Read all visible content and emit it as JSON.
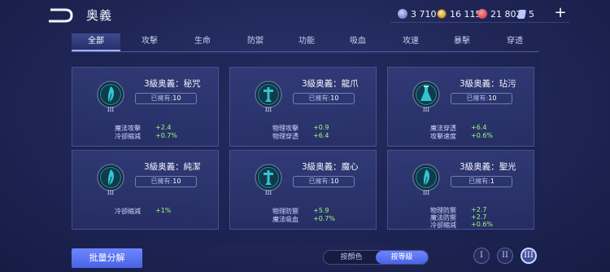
{
  "header": {
    "title": "奥義",
    "resources": {
      "gems": "3 710",
      "gold": "16 115",
      "ruby": "21 802",
      "tickets": "5"
    },
    "add_label": "+"
  },
  "tabs": [
    {
      "label": "全部",
      "active": true
    },
    {
      "label": "攻擊"
    },
    {
      "label": "生命"
    },
    {
      "label": "防禦"
    },
    {
      "label": "功能"
    },
    {
      "label": "吸血"
    },
    {
      "label": "攻速"
    },
    {
      "label": "暴擊"
    },
    {
      "label": "穿透"
    }
  ],
  "cards": [
    {
      "name": "3級奥義：秘咒",
      "owned_prefix": "已擁有:",
      "owned": "10",
      "emblem": "feather-icon",
      "stats": [
        {
          "name": "魔法攻擊",
          "value": "+2.4"
        },
        {
          "name": "冷卻縮減",
          "value": "+0.7%"
        }
      ]
    },
    {
      "name": "3級奥義：龍爪",
      "owned_prefix": "已擁有:",
      "owned": "10",
      "emblem": "figure-icon",
      "stats": [
        {
          "name": "物理攻擊",
          "value": "+0.9"
        },
        {
          "name": "物理穿透",
          "value": "+6.4"
        }
      ]
    },
    {
      "name": "3級奥義：玷污",
      "owned_prefix": "已擁有:",
      "owned": "10",
      "emblem": "flask-icon",
      "stats": [
        {
          "name": "魔法穿透",
          "value": "+6.4"
        },
        {
          "name": "攻擊速度",
          "value": "+0.6%"
        }
      ]
    },
    {
      "name": "3級奥義：純潔",
      "owned_prefix": "已擁有:",
      "owned": "10",
      "emblem": "feather-icon",
      "stats": [
        {
          "name": "冷卻縮減",
          "value": "+1%"
        }
      ]
    },
    {
      "name": "3級奥義：魔心",
      "owned_prefix": "已擁有:",
      "owned": "10",
      "emblem": "figure-icon",
      "stats": [
        {
          "name": "物理防禦",
          "value": "+5.9"
        },
        {
          "name": "魔法吸血",
          "value": "+0.7%"
        }
      ]
    },
    {
      "name": "3級奥義：聖光",
      "owned_prefix": "已擁有:",
      "owned": "1",
      "emblem": "feather-icon",
      "stats": [
        {
          "name": "物理防禦",
          "value": "+2.7"
        },
        {
          "name": "魔法防禦",
          "value": "+2.7"
        },
        {
          "name": "冷卻縮減",
          "value": "+0.6%"
        }
      ]
    }
  ],
  "emblem_level": "III",
  "footer": {
    "batch_label": "批量分解",
    "sort_options": [
      "按顏色",
      "按等級"
    ],
    "sort_active": 1,
    "levels": [
      "I",
      "II",
      "III"
    ],
    "level_active": 2
  },
  "colors": {
    "accent": "#5a73f0",
    "stat_value": "#9cff7a",
    "emblem_teal": "#1fa7b0"
  }
}
